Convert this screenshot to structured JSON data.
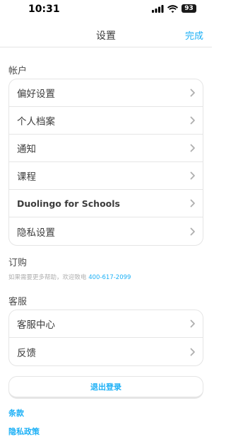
{
  "status": {
    "time": "10:31",
    "battery": "93",
    "signal_icon": "cellular-signal-icon",
    "wifi_icon": "wifi-icon"
  },
  "nav": {
    "title": "设置",
    "done_label": "完成"
  },
  "account": {
    "header": "帐户",
    "items": [
      {
        "label": "偏好设置"
      },
      {
        "label": "个人档案"
      },
      {
        "label": "通知"
      },
      {
        "label": "课程"
      },
      {
        "label": "Duolingo for Schools"
      },
      {
        "label": "隐私设置"
      }
    ]
  },
  "subscription": {
    "header": "订购",
    "help_text": "如果需要更多帮助，欢迎致电 ",
    "help_phone": "400-617-2099"
  },
  "support": {
    "header": "客服",
    "items": [
      {
        "label": "客服中心"
      },
      {
        "label": "反馈"
      }
    ]
  },
  "logout_label": "退出登录",
  "links": {
    "terms": "条款",
    "privacy": "隐私政策"
  },
  "colors": {
    "accent": "#1cb0f6",
    "border": "#e5e5e5",
    "text": "#3c3c3c"
  }
}
